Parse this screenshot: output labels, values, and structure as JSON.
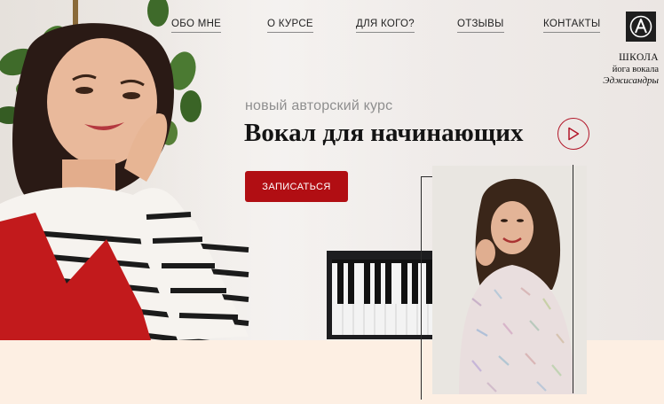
{
  "nav": {
    "items": [
      {
        "label": "ОБО МНЕ"
      },
      {
        "label": "О КУРСЕ"
      },
      {
        "label": "ДЛЯ КОГО?"
      },
      {
        "label": "ОТЗЫВЫ"
      },
      {
        "label": "КОНТАКТЫ"
      }
    ]
  },
  "logo": {
    "letter": "A",
    "line1": "ШКОЛА",
    "line2": "йога вокала",
    "line3": "Эджисандры"
  },
  "hero": {
    "subtitle": "новый авторский курс",
    "title": "Вокал для начинающих",
    "cta_label": "ЗАПИСАТЬСЯ"
  },
  "colors": {
    "accent": "#b10e13",
    "play_ring": "#b2172a",
    "bottom_band": "#fdefe3",
    "logo_box": "#1e1e1e"
  },
  "icons": {
    "play": "play-icon",
    "logo": "logo-a-icon"
  }
}
